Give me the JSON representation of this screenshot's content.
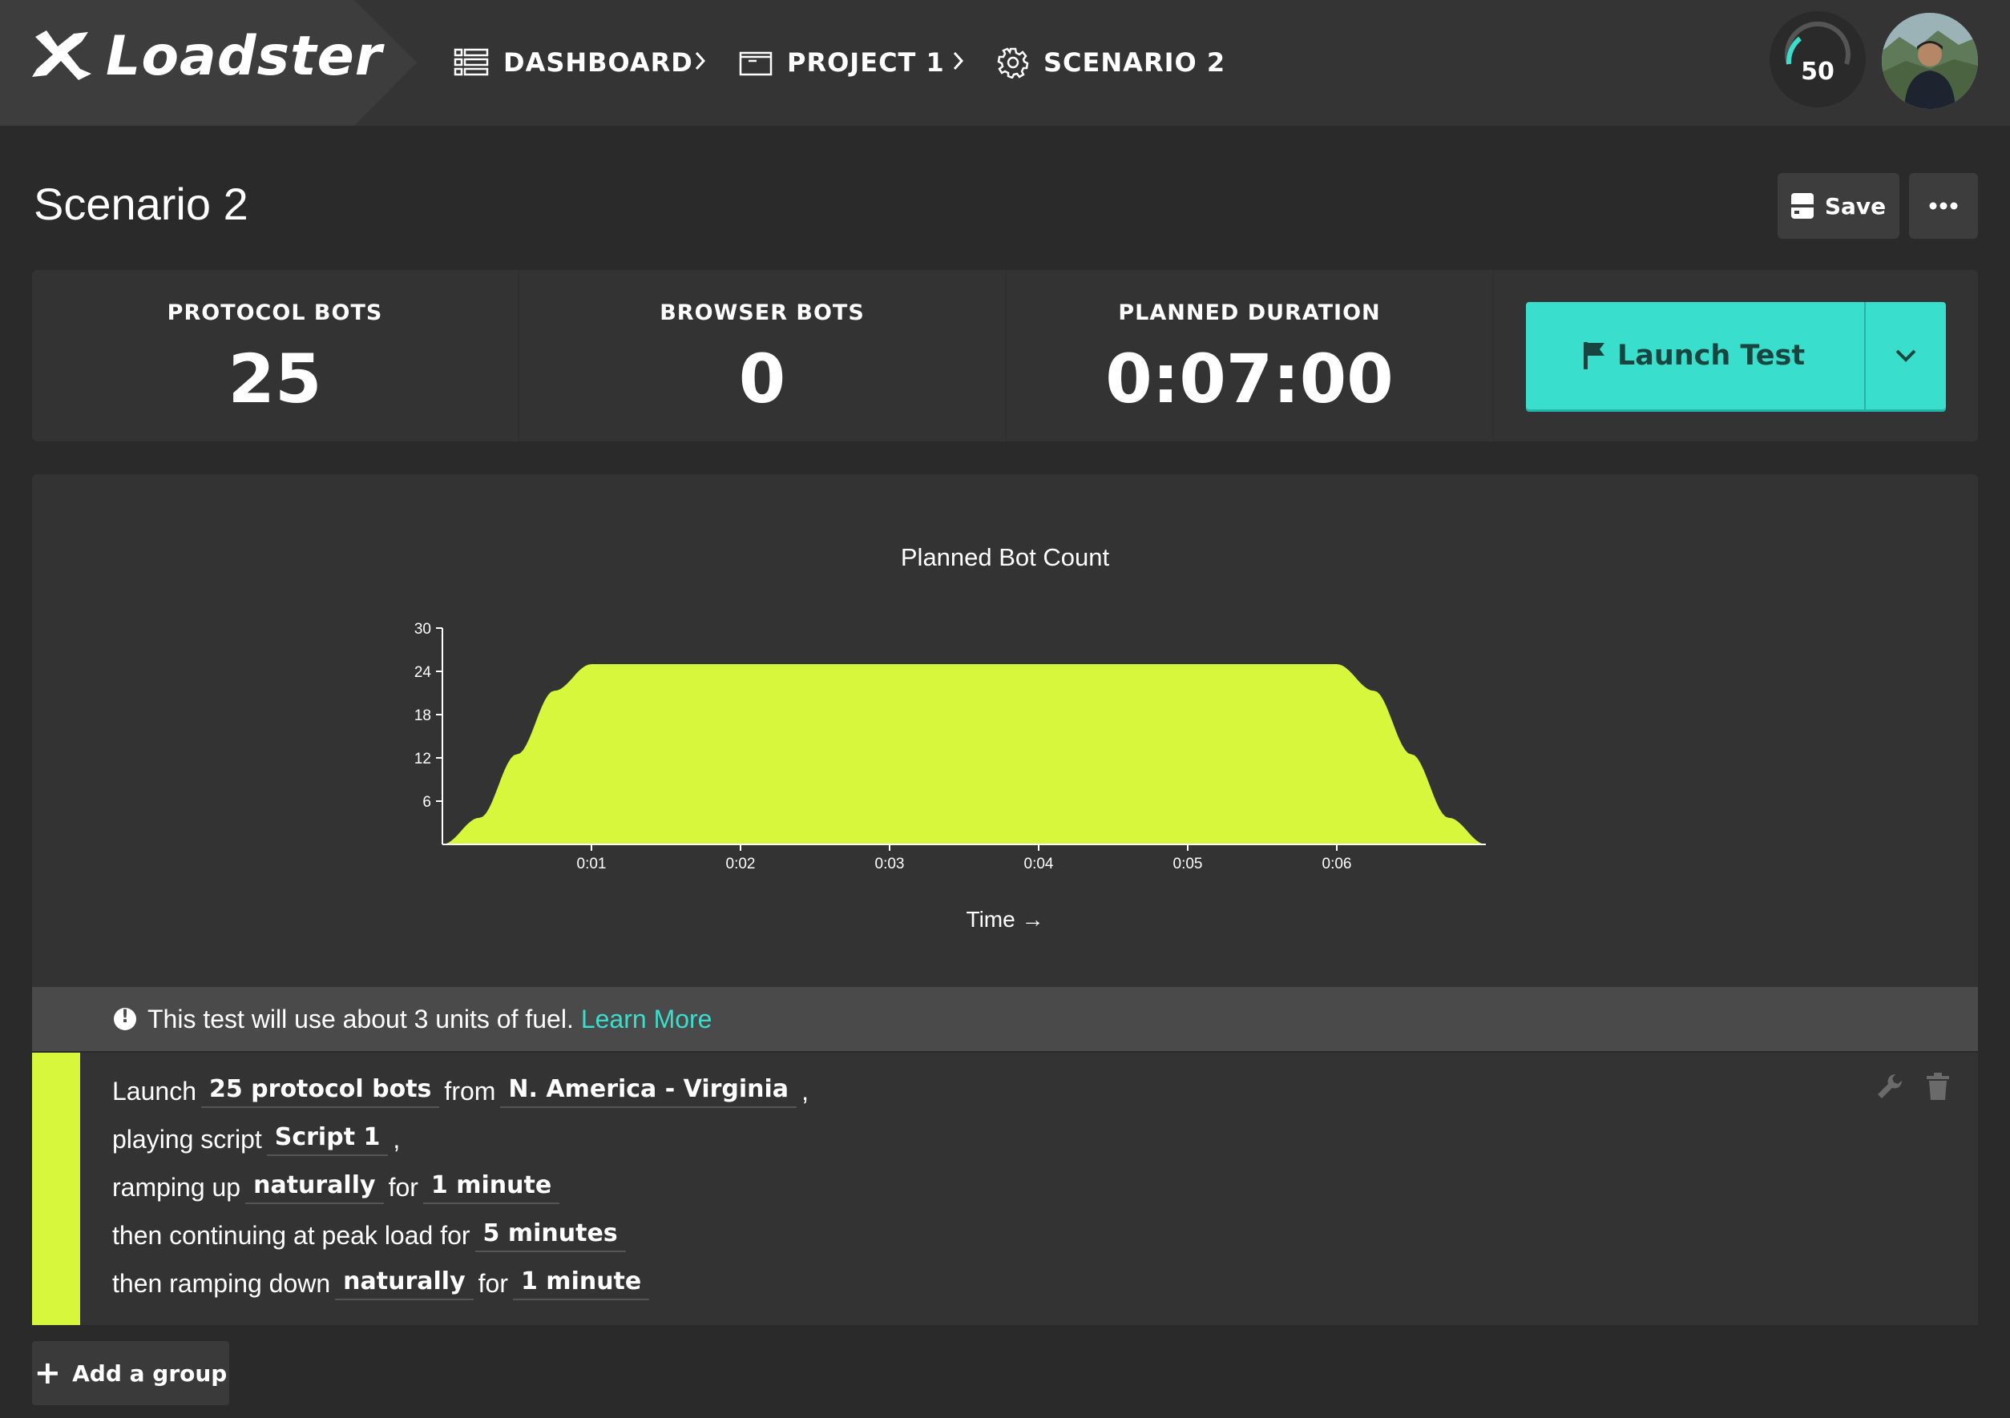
{
  "app": {
    "name": "Loadster"
  },
  "breadcrumbs": [
    {
      "label": "DASHBOARD",
      "icon": "dashboard-list-icon"
    },
    {
      "label": "PROJECT 1",
      "icon": "folder-icon"
    },
    {
      "label": "SCENARIO 2",
      "icon": "gear-icon"
    }
  ],
  "fuel": {
    "gauge_value": "50",
    "gauge_fraction": 0.15
  },
  "page": {
    "title": "Scenario 2"
  },
  "toolbar": {
    "save_label": "Save",
    "more_icon": "ellipsis-icon"
  },
  "stats": [
    {
      "label": "PROTOCOL BOTS",
      "value": "25"
    },
    {
      "label": "BROWSER BOTS",
      "value": "0"
    },
    {
      "label": "PLANNED DURATION",
      "value": "0:07:00"
    }
  ],
  "launch": {
    "label": "Launch Test",
    "icon": "flag-icon",
    "dropdown_icon": "chevron-down-icon"
  },
  "chart_data": {
    "type": "area",
    "title": "Planned Bot Count",
    "xlabel": "Time →",
    "ylabel": "",
    "x_unit": "minutes",
    "x": [
      0,
      0.25,
      0.5,
      0.75,
      1.0,
      6.0,
      6.25,
      6.5,
      6.75,
      7.0
    ],
    "y": [
      0,
      3.7,
      12.5,
      21.3,
      25,
      25,
      21.3,
      12.5,
      3.7,
      0
    ],
    "xlim": [
      0,
      7
    ],
    "ylim": [
      0,
      30
    ],
    "yticks": [
      6,
      12,
      18,
      24,
      30
    ],
    "xticks": [
      {
        "value": 1,
        "label": "0:01"
      },
      {
        "value": 2,
        "label": "0:02"
      },
      {
        "value": 3,
        "label": "0:03"
      },
      {
        "value": 4,
        "label": "0:04"
      },
      {
        "value": 5,
        "label": "0:05"
      },
      {
        "value": 6,
        "label": "0:06"
      }
    ],
    "color": "#d6f73c",
    "grid": false
  },
  "notice": {
    "text": "This test will use about 3 units of fuel.",
    "link": "Learn More"
  },
  "group": {
    "color": "#d6f73c",
    "line1": {
      "t1": "Launch",
      "bots": "25 protocol bots",
      "t2": "from",
      "region": "N. America - Virginia",
      "t3": ","
    },
    "line2": {
      "t1": "playing script",
      "script": "Script 1",
      "t2": ","
    },
    "line3": {
      "t1": "ramping up",
      "mode": "naturally",
      "t2": "for",
      "duration": "1 minute"
    },
    "line4": {
      "t1": "then continuing at peak load for",
      "duration": "5 minutes"
    },
    "line5": {
      "t1": "then ramping down",
      "mode": "naturally",
      "t2": "for",
      "duration": "1 minute"
    }
  },
  "add_group": {
    "label": "Add a group"
  }
}
